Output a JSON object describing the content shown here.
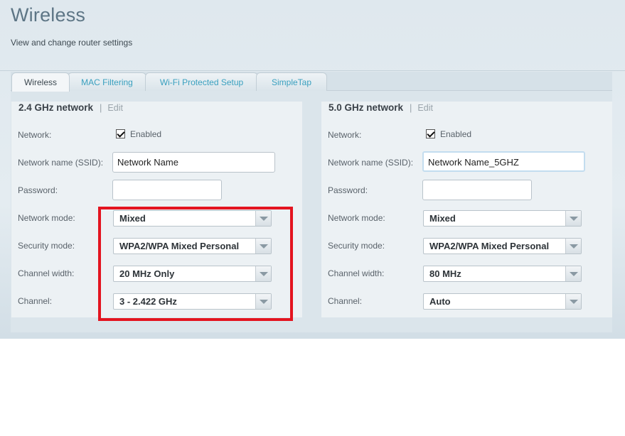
{
  "page": {
    "title": "Wireless",
    "subtitle": "View and change router settings"
  },
  "tabs": [
    {
      "label": "Wireless",
      "active": true
    },
    {
      "label": "MAC Filtering",
      "active": false
    },
    {
      "label": "Wi-Fi Protected Setup",
      "active": false
    },
    {
      "label": "SimpleTap",
      "active": false
    }
  ],
  "labels": {
    "network": "Network:",
    "ssid": "Network name (SSID):",
    "password": "Password:",
    "network_mode": "Network mode:",
    "security_mode": "Security mode:",
    "channel_width": "Channel width:",
    "channel": "Channel:",
    "enabled": "Enabled",
    "separator": "|",
    "edit": "Edit"
  },
  "band_24": {
    "title": "2.4 GHz network",
    "enabled": true,
    "ssid": "Network Name",
    "password": "",
    "network_mode": "Mixed",
    "security_mode": "WPA2/WPA Mixed Personal",
    "channel_width": "20 MHz Only",
    "channel": "3 - 2.422 GHz"
  },
  "band_5": {
    "title": "5.0 GHz network",
    "enabled": true,
    "ssid": "Network Name_5GHZ",
    "password": "",
    "network_mode": "Mixed",
    "security_mode": "WPA2/WPA Mixed Personal",
    "channel_width": "80 MHz",
    "channel": "Auto"
  },
  "colors": {
    "highlight": "#e3141f",
    "tab_link": "#3aa0bf",
    "title": "#5d7585"
  },
  "icons": {
    "checkbox": "checkmark-icon",
    "dropdown": "chevron-down-icon"
  }
}
